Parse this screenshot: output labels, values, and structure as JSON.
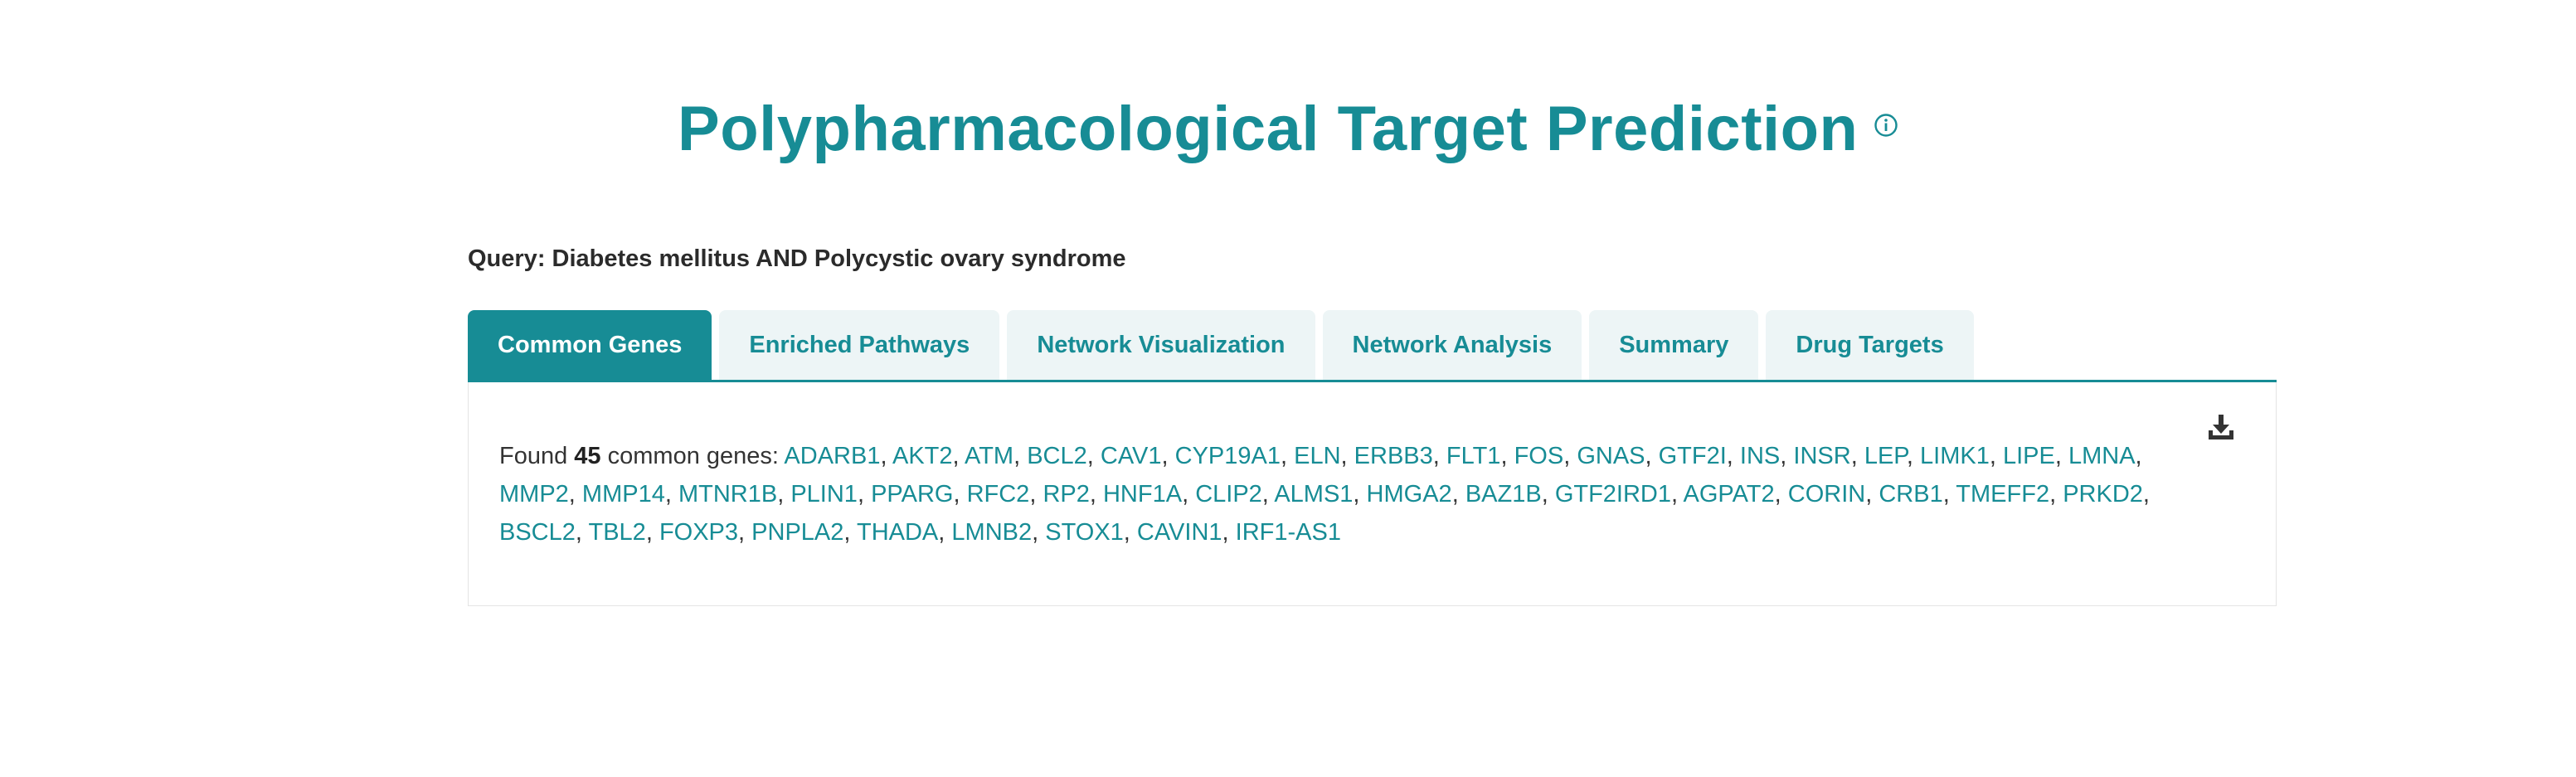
{
  "header": {
    "title": "Polypharmacological Target Prediction",
    "info_icon": "info-circle-icon"
  },
  "query": {
    "text": "Query: Diabetes mellitus AND Polycystic ovary syndrome"
  },
  "tabs": [
    {
      "label": "Common Genes",
      "active": true
    },
    {
      "label": "Enriched Pathways",
      "active": false
    },
    {
      "label": "Network Visualization",
      "active": false
    },
    {
      "label": "Network Analysis",
      "active": false
    },
    {
      "label": "Summary",
      "active": false
    },
    {
      "label": "Drug Targets",
      "active": false
    }
  ],
  "panel": {
    "download_icon": "download-icon",
    "found_prefix": "Found",
    "count": "45",
    "found_suffix": "common genes:",
    "genes": [
      "ADARB1",
      "AKT2",
      "ATM",
      "BCL2",
      "CAV1",
      "CYP19A1",
      "ELN",
      "ERBB3",
      "FLT1",
      "FOS",
      "GNAS",
      "GTF2I",
      "INS",
      "INSR",
      "LEP",
      "LIMK1",
      "LIPE",
      "LMNA",
      "MMP2",
      "MMP14",
      "MTNR1B",
      "PLIN1",
      "PPARG",
      "RFC2",
      "RP2",
      "HNF1A",
      "CLIP2",
      "ALMS1",
      "HMGA2",
      "BAZ1B",
      "GTF2IRD1",
      "AGPAT2",
      "CORIN",
      "CRB1",
      "TMEFF2",
      "PRKD2",
      "BSCL2",
      "TBL2",
      "FOXP3",
      "PNPLA2",
      "THADA",
      "LMNB2",
      "STOX1",
      "CAVIN1",
      "IRF1-AS1"
    ]
  },
  "colors": {
    "accent": "#178c95",
    "tab_inactive_bg": "#edf5f6",
    "text": "#333333"
  }
}
